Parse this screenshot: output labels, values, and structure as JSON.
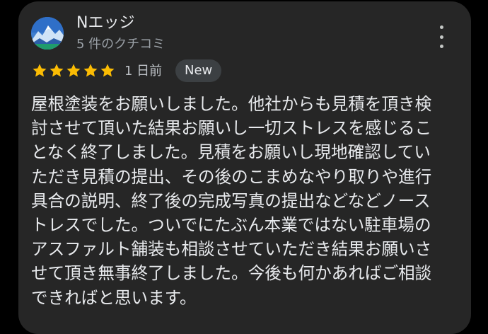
{
  "review": {
    "author_name": "Nエッジ",
    "author_meta": "5 件のクチコミ",
    "rating": 5,
    "max_rating": 5,
    "date": "1 日前",
    "badge": "New",
    "text": "屋根塗装をお願いしました。他社からも見積を頂き検\n討させて頂いた結果お願いし一切ストレスを感じるこ\nとなく終了しました。見積をお願いし現地確認してい\nただき見積の提出、その後のこまめなやり取りや進行\n具合の説明、終了後の完成写真の提出などなどノース\nトレスでした。ついでにたぶん本業ではない駐車場の\nアスファルト舗装も相談させていただき結果お願いさ\nせて頂き無事終了しました。今後も何かあればご相談\nできればと思います。"
  },
  "icons": {
    "avatar": "mountain-avatar-icon",
    "more": "more-vert-icon",
    "star": "star-icon"
  },
  "colors": {
    "background": "#000000",
    "card": "#262626",
    "star": "#fbbc04",
    "badge_bg": "#3c4043",
    "text_primary": "#e8eaed",
    "text_secondary": "#9aa0a6"
  }
}
